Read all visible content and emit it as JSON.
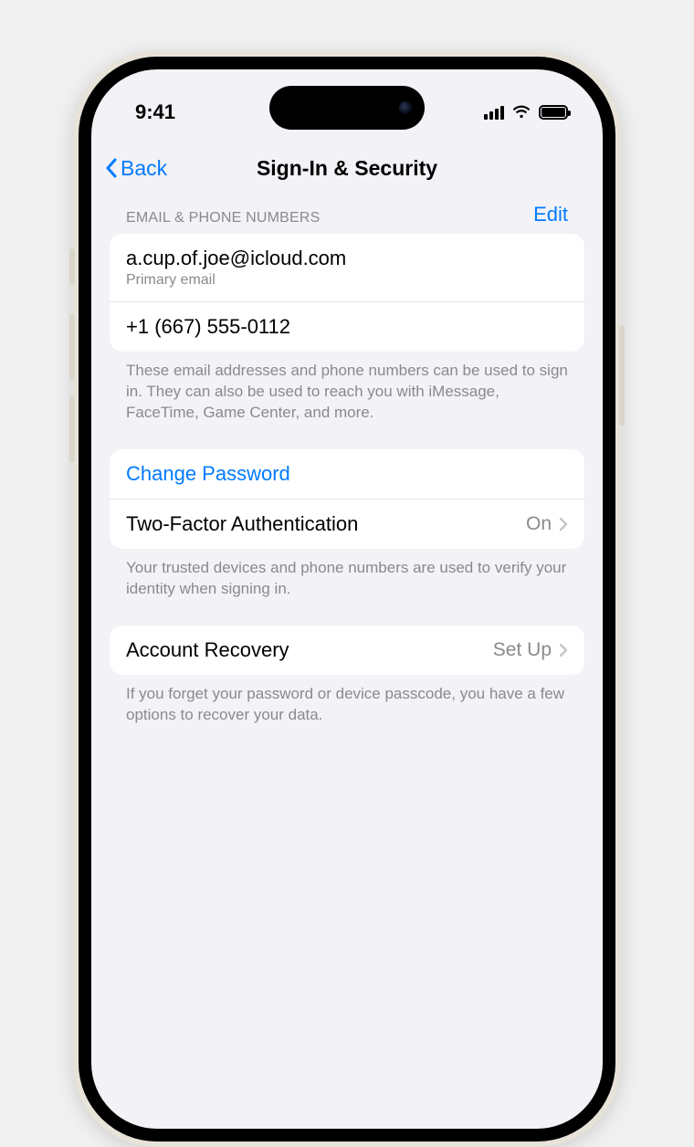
{
  "status": {
    "time": "9:41"
  },
  "nav": {
    "back": "Back",
    "title": "Sign-In & Security"
  },
  "section1": {
    "header": "Email & Phone Numbers",
    "edit": "Edit",
    "email": "a.cup.of.joe@icloud.com",
    "email_sub": "Primary email",
    "phone": "+1 (667) 555-0112",
    "footer": "These email addresses and phone numbers can be used to sign in. They can also be used to reach you with iMessage, FaceTime, Game Center, and more."
  },
  "section2": {
    "change_password": "Change Password",
    "twofa_label": "Two-Factor Authentication",
    "twofa_value": "On",
    "footer": "Your trusted devices and phone numbers are used to verify your identity when signing in."
  },
  "section3": {
    "recovery_label": "Account Recovery",
    "recovery_value": "Set Up",
    "footer": "If you forget your password or device passcode, you have a few options to recover your data."
  }
}
